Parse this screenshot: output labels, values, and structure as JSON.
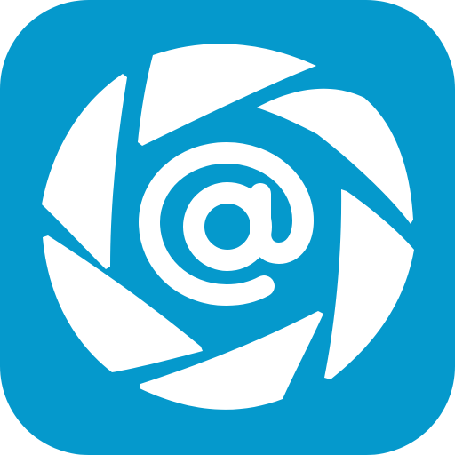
{
  "icon": {
    "name": "aperture-at-sign-app-icon",
    "glyph": "@",
    "colors": {
      "tile": "#0599CC",
      "foreground": "#FFFFFF"
    }
  }
}
